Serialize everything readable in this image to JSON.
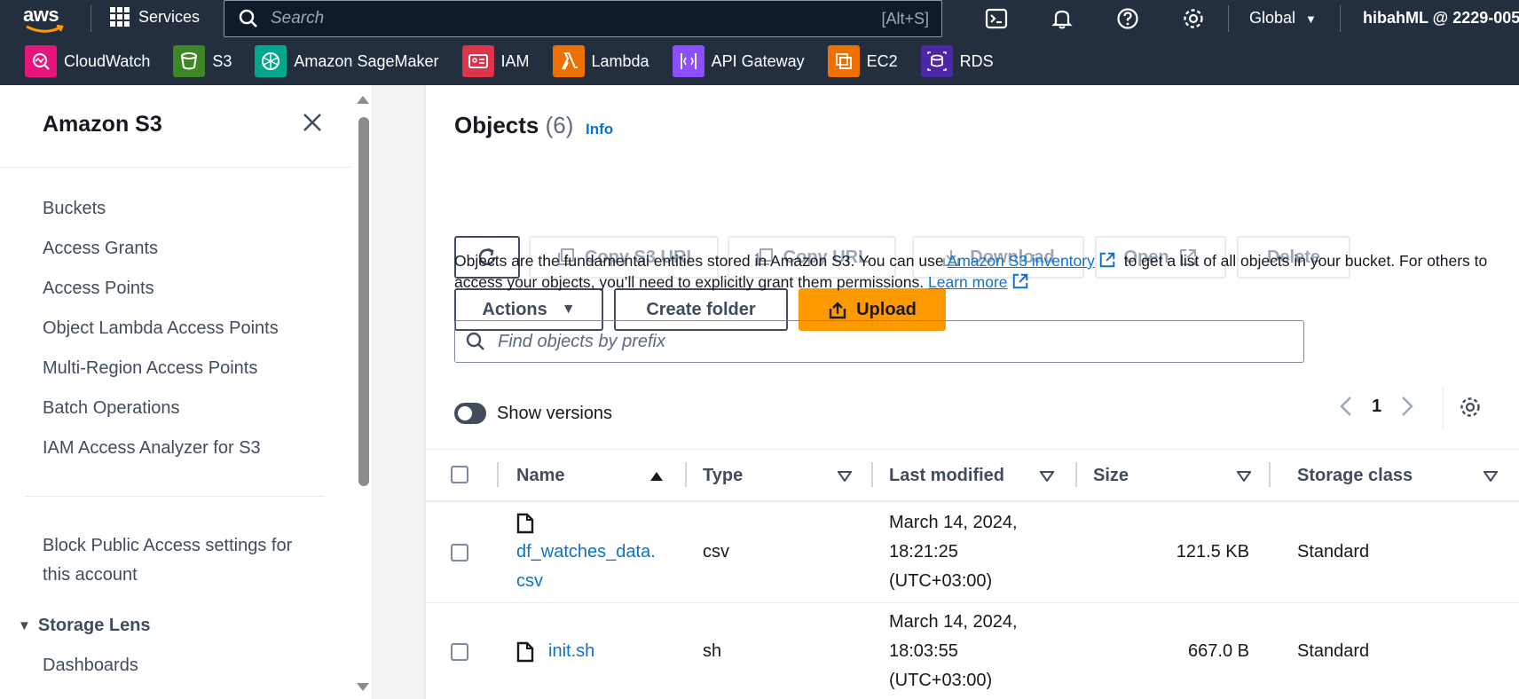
{
  "topnav": {
    "logo_text": "aws",
    "services_label": "Services",
    "search_placeholder": "Search",
    "search_shortcut": "[Alt+S]",
    "region_label": "Global",
    "account_label": "hibahML @ 2229-005"
  },
  "favorites": [
    {
      "label": "CloudWatch",
      "color": "#e7157b",
      "icon": "cloudwatch-icon"
    },
    {
      "label": "S3",
      "color": "#3f8624",
      "icon": "s3-icon"
    },
    {
      "label": "Amazon SageMaker",
      "color": "#01a88d",
      "icon": "sagemaker-icon"
    },
    {
      "label": "IAM",
      "color": "#dd344c",
      "icon": "iam-icon"
    },
    {
      "label": "Lambda",
      "color": "#ed7100",
      "icon": "lambda-icon"
    },
    {
      "label": "API Gateway",
      "color": "#8c4fff",
      "icon": "api-gateway-icon"
    },
    {
      "label": "EC2",
      "color": "#ed7100",
      "icon": "ec2-icon"
    },
    {
      "label": "RDS",
      "color": "#4d27aa",
      "icon": "rds-icon"
    }
  ],
  "sidebar": {
    "title": "Amazon S3",
    "items": [
      {
        "label": "Buckets"
      },
      {
        "label": "Access Grants"
      },
      {
        "label": "Access Points"
      },
      {
        "label": "Object Lambda Access Points"
      },
      {
        "label": "Multi-Region Access Points"
      },
      {
        "label": "Batch Operations"
      },
      {
        "label": "IAM Access Analyzer for S3"
      }
    ],
    "block_public_line1": "Block Public Access settings for",
    "block_public_line2": "this account",
    "storage_lens_label": "Storage Lens",
    "dashboards_label": "Dashboards"
  },
  "objects": {
    "title": "Objects",
    "count": "(6)",
    "info_label": "Info",
    "buttons": {
      "copy_s3_uri": "Copy S3 URI",
      "copy_url": "Copy URL",
      "download": "Download",
      "open": "Open",
      "delete": "Delete",
      "actions": "Actions",
      "create_folder": "Create folder",
      "upload": "Upload"
    },
    "desc_part1": "Objects are the fundamental entities stored in Amazon S3. You can use",
    "desc_link1": "Amazon S3 inventory",
    "desc_part2": "to get a list of all objects in your bucket. For",
    "desc_part3": "others to access your objects, you’ll need to explicitly grant them permissions.",
    "desc_link2": "Learn more",
    "search_placeholder": "Find objects by prefix",
    "show_versions_label": "Show versions",
    "page_number": "1"
  },
  "table": {
    "columns": [
      "Name",
      "Type",
      "Last modified",
      "Size",
      "Storage class"
    ],
    "rows": [
      {
        "name_line1": "df_watches_data.",
        "name_line2": "csv",
        "type": "csv",
        "modified_line1": "March 14, 2024,",
        "modified_line2": "18:21:25",
        "modified_line3": "(UTC+03:00)",
        "size": "121.5 KB",
        "storage_class": "Standard"
      },
      {
        "name_line1": "init.sh",
        "name_line2": "",
        "type": "sh",
        "modified_line1": "March 14, 2024,",
        "modified_line2": "18:03:55",
        "modified_line3": "(UTC+03:00)",
        "size": "667.0 B",
        "storage_class": "Standard"
      }
    ]
  },
  "colors": {
    "nav_bg": "#232f3e",
    "link": "#0972d3",
    "primary": "#ff9900"
  }
}
